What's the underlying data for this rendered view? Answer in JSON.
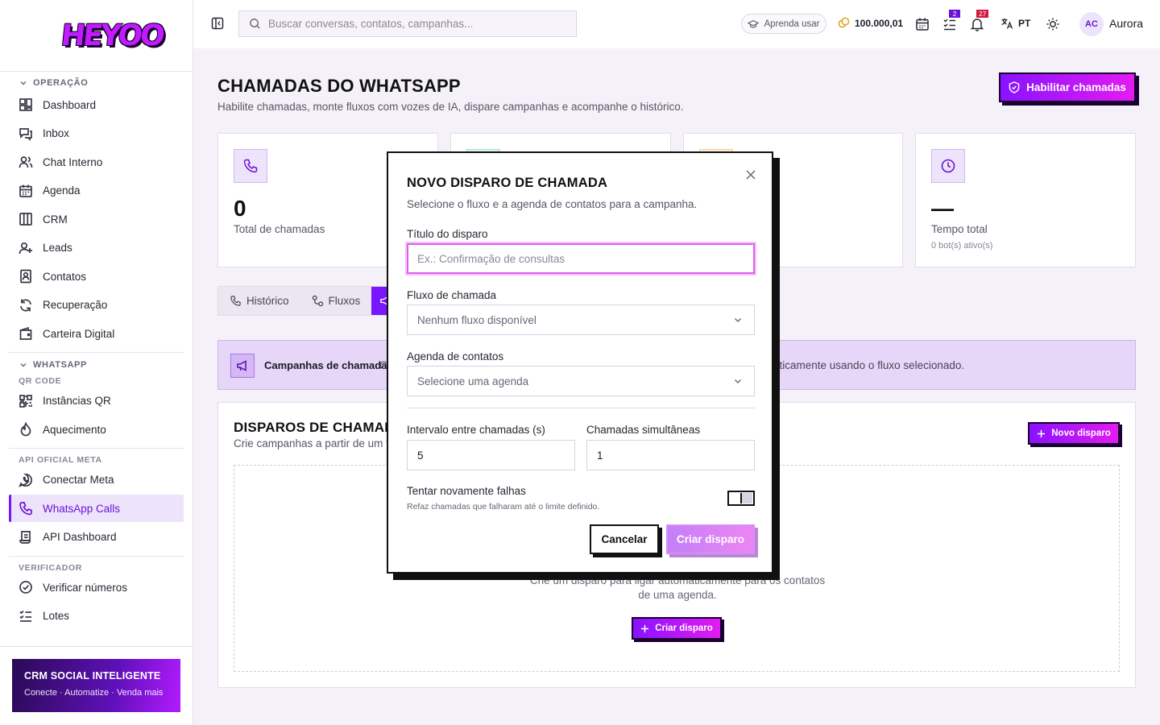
{
  "app": {
    "logo": "HEYOO"
  },
  "sidebar": {
    "section_operacao": "OPERAÇÃO",
    "operacao_items": [
      {
        "label": "Dashboard",
        "icon": "dashboard-icon"
      },
      {
        "label": "Inbox",
        "icon": "inbox-icon"
      },
      {
        "label": "Chat Interno",
        "icon": "users-icon"
      },
      {
        "label": "Agenda",
        "icon": "calendar-icon"
      },
      {
        "label": "CRM",
        "icon": "kanban-icon"
      },
      {
        "label": "Leads",
        "icon": "user-plus-icon"
      },
      {
        "label": "Contatos",
        "icon": "contact-icon"
      },
      {
        "label": "Recuperação",
        "icon": "refresh-icon"
      },
      {
        "label": "Carteira Digital",
        "icon": "wallet-icon"
      }
    ],
    "section_whatsapp": "WHATSAPP",
    "sub_qr": "QR CODE",
    "qr_items": [
      {
        "label": "Instâncias QR",
        "icon": "qr-icon"
      },
      {
        "label": "Aquecimento",
        "icon": "flame-icon"
      }
    ],
    "sub_meta": "API OFICIAL META",
    "meta_items": [
      {
        "label": "Conectar Meta",
        "icon": "whatsapp-icon"
      },
      {
        "label": "WhatsApp Calls",
        "icon": "phone-icon"
      },
      {
        "label": "API Dashboard",
        "icon": "scroll-icon"
      }
    ],
    "sub_verificador": "VERIFICADOR",
    "verificador_items": [
      {
        "label": "Verificar números",
        "icon": "check-circle-icon"
      },
      {
        "label": "Lotes",
        "icon": "list-check-icon"
      }
    ],
    "promo_title": "CRM SOCIAL INTELIGENTE",
    "promo_sub": "Conecte · Automatize · Venda mais"
  },
  "topbar": {
    "search_placeholder": "Buscar conversas, contatos, campanhas...",
    "learn_label": "Aprenda usar",
    "coins": "100.000,01",
    "tasks_badge": "2",
    "notif_badge": "27",
    "lang": "PT",
    "avatar_initials": "AC",
    "username": "Aurora"
  },
  "page": {
    "title": "CHAMADAS DO WHATSAPP",
    "subtitle": "Habilite chamadas, monte fluxos com vozes de IA, dispare campanhas e acompanhe o histórico.",
    "enable_button": "Habilitar chamadas",
    "card_total_value": "0",
    "card_total_label": "Total de chamadas",
    "card_time_value": "—",
    "card_time_label": "Tempo total",
    "card_time_sub": "0 bot(s) ativo(s)",
    "tabs": [
      "Histórico",
      "Fluxos"
    ],
    "banner_title": "Campanhas de chamada",
    "banner_desc_prefix": "C",
    "banner_desc": "aticamente usando o fluxo selecionado.",
    "panel_title": "DISPAROS DE CHAMADA",
    "panel_sub": "Crie campanhas a partir de um flu",
    "new_button": "Novo disparo",
    "empty_text_1": "Crie um disparo para ligar automaticamente para os contatos",
    "empty_text_2": "de uma agenda.",
    "empty_button": "Criar disparo"
  },
  "modal": {
    "title": "NOVO DISPARO DE CHAMADA",
    "subtitle": "Selecione o fluxo e a agenda de contatos para a campanha.",
    "title_label": "Título do disparo",
    "title_placeholder": "Ex.: Confirmação de consultas",
    "flow_label": "Fluxo de chamada",
    "flow_value": "Nenhum fluxo disponível",
    "agenda_label": "Agenda de contatos",
    "agenda_value": "Selecione uma agenda",
    "interval_label": "Intervalo entre chamadas (s)",
    "interval_value": "5",
    "concurrent_label": "Chamadas simultâneas",
    "concurrent_value": "1",
    "retry_label": "Tentar novamente falhas",
    "retry_hint": "Refaz chamadas que falharam até o limite definido.",
    "retry_enabled": false,
    "cancel": "Cancelar",
    "create": "Criar disparo"
  },
  "colors": {
    "accent": "#7a16ff",
    "accent2": "#e31cf0",
    "ink": "#1a0030"
  }
}
